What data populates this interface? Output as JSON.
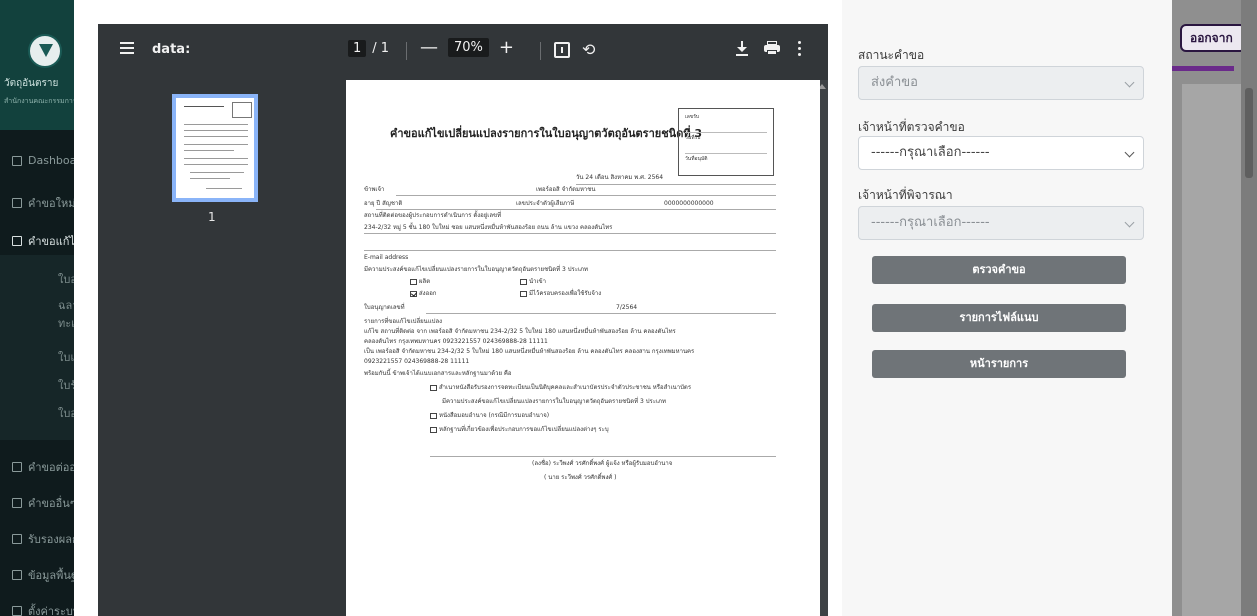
{
  "app": {
    "brand_title": "วัตถุอันตราย",
    "brand_subtitle": "สำนักงานคณะกรรมการอาหารและยา",
    "nav": [
      {
        "label": "Dashboard",
        "icon": "dashboard-icon"
      },
      {
        "label": "คำขอใหม่",
        "icon": "document-icon"
      },
      {
        "label": "คำขอแก้ไข",
        "icon": "edit-icon"
      },
      {
        "label": "คำขอต่ออายุ",
        "icon": "renew-icon"
      },
      {
        "label": "คำขออื่นๆ",
        "icon": "list-icon"
      },
      {
        "label": "รับรองผลการตรวจ",
        "icon": "card-icon"
      },
      {
        "label": "ข้อมูลพื้นฐาน",
        "icon": "menu-icon"
      },
      {
        "label": "ตั้งค่าระบบ",
        "icon": "settings-icon"
      }
    ],
    "nav_sub": [
      "ใบอนุญาต",
      "ฉลาก",
      "ทะเบียน",
      "ใบแจ้ง",
      "ใบรับแจ้ง",
      "ใบอนุญาตนำเข้า"
    ],
    "top_right_button": "ออกจากระบบ"
  },
  "pdf": {
    "title": "data:",
    "page_current": "1",
    "page_total": "/ 1",
    "zoom_out": "—",
    "zoom": "70%",
    "zoom_in": "+",
    "thumbnail_number": "1"
  },
  "document": {
    "title": "คำขอแก้ไขเปลี่ยนแปลงรายการในใบอนุญาตวัตถุอันตรายชนิดที่ 3",
    "stamp": [
      "เลขรับ",
      "วันที่รับ",
      "วันที่อนุมัติ"
    ],
    "date_line": "วัน  24   เดือน   สิงหาคม    พ.ศ.      2564",
    "applicant_label": "ข้าพเจ้า",
    "applicant_value": "เพอร์ออสิ จำกัดมหาชน",
    "age_line": "อายุ            ปี   สัญชาติ",
    "id_label": "เลขประจำตัวผู้เสียภาษี",
    "id_value": "0000000000000",
    "place_label": "สถานที่ติดต่อของผู้ประกอบการดำเนินการ ตั้งอยู่เลขที่",
    "address": "234-2/32 หมู่ 5  ชั้น 180 ใบใหม่ ซอย แสนหนึ่งหมื่นห้าพันสองร้อย ถนน ล้าน แขวง คลองตันไทร",
    "email_label": "E-mail address",
    "purpose": "มีความประสงค์ขอแก้ไขเปลี่ยนแปลงรายการในใบอนุญาตวัตถุอันตรายชนิดที่ 3 ประเภท",
    "opt_produce": "ผลิต",
    "opt_import": "นำเข้า",
    "opt_export": "ส่งออก",
    "opt_possess": "มีไว้ครอบครองเพื่อใช้รับจ้าง",
    "license_label": "ใบอนุญาตเลขที่",
    "license_value": "7/2564",
    "change_header": "รายการที่ขอแก้ไขเปลี่ยนแปลง",
    "change_1": "แก้ไข  สถานที่ติดต่อ จาก   เพอร์ออสิ จำกัดมหาชน 234-2/32 5   ใบใหม่ 180 แสนหนึ่งหมื่นห้าพันสองร้อย ล้าน คลองตันไทร",
    "change_2": "คลองตันไทร กรุงเทพมหานคร 0923221557 024369888-28 11111",
    "change_3": "เป็น  เพอร์ออสิ จำกัดมหาชน 234-2/32 5  ใบใหม่ 180 แสนหนึ่งหมื่นห้าพันสองร้อย ล้าน คลองตันไทร คลองสาน กรุงเทพมหานคร",
    "change_4": "0923221557 024369888-28 11111",
    "attach_header": "พร้อมกันนี้ ข้าพเจ้าได้แนบเอกสารและหลักฐานมาด้วย คือ",
    "attach_1": "สำเนาหนังสือรับรองการจดทะเบียนเป็นนิติบุคคลและสำเนาบัตรประจำตัวประชาชน หรือสำเนาบัตร",
    "attach_1b": "มีความประสงค์ขอแก้ไขเปลี่ยนแปลงรายการในใบอนุญาตวัตถุอันตรายชนิดที่ 3 ประเภท",
    "attach_2": "หนังสือมอบอำนาจ (กรณีมีการมอบอำนาจ)",
    "attach_3": "หลักฐานที่เกี่ยวข้องเพื่อประกอบการขอแก้ไขเปลี่ยนแปลงต่างๆ ระบุ",
    "sign_line": "(ลงชื่อ)      ระวีพงศ์  วรศักดิ์พงศ์         ผู้แจ้ง หรือผู้รับมอบอำนาจ",
    "sign_name": "(    นาย ระวีพงศ์  วรศักดิ์พงศ์     )"
  },
  "form": {
    "status_label": "สถานะคำขอ",
    "status_value": "ส่งคำขอ",
    "checker_label": "เจ้าหน้าที่ตรวจคำขอ",
    "checker_value": "------กรุณาเลือก------",
    "approver_label": "เจ้าหน้าที่พิจารณา",
    "approver_value": "------กรุณาเลือก------",
    "btn_check": "ตรวจคำขอ",
    "btn_attachments": "รายการไฟล์แนบ",
    "btn_list": "หน้ารายการ"
  }
}
